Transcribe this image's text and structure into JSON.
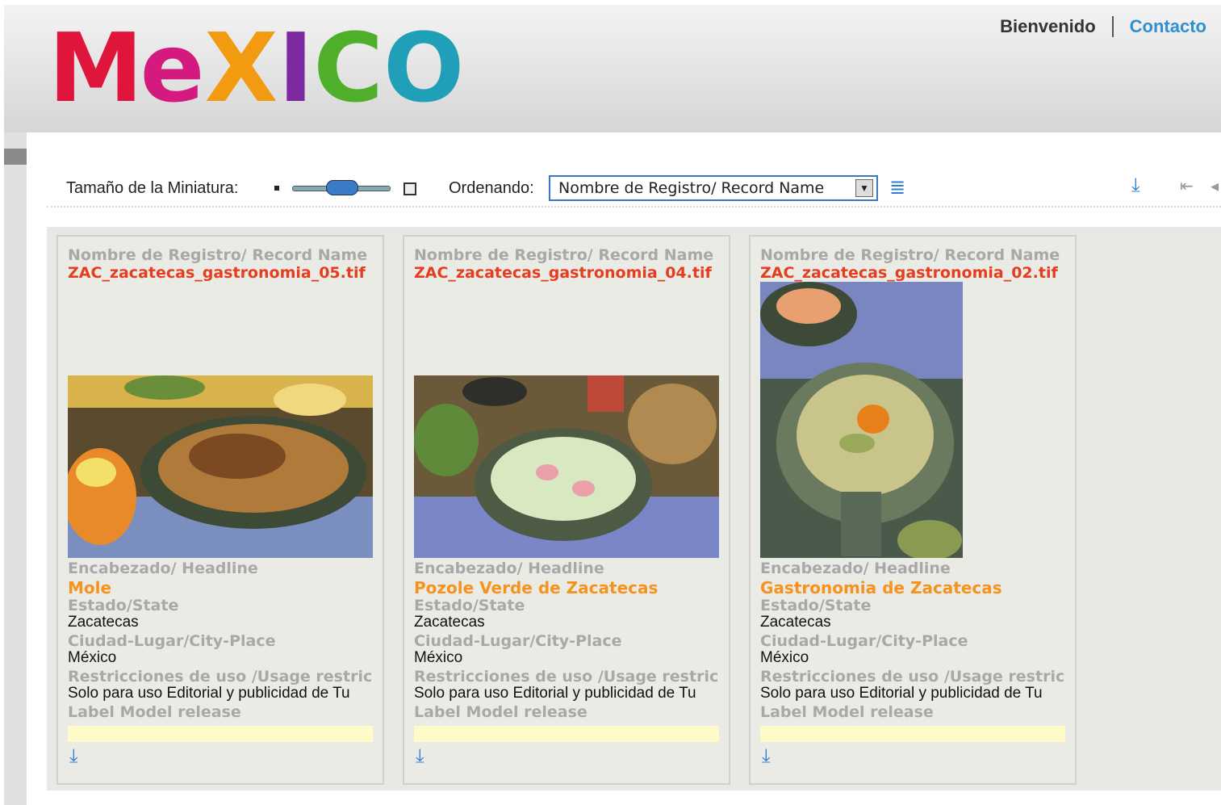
{
  "header": {
    "logo_letters": [
      "M",
      "e",
      "X",
      "I",
      "C",
      "O"
    ],
    "welcome": "Bienvenido",
    "contact": "Contacto"
  },
  "toolbar": {
    "thumb_size_label": "Tamaño de la Miniatura:",
    "sort_label": "Ordenando:",
    "sort_value": "Nombre de Registro/ Record Name"
  },
  "labels": {
    "record": "Nombre de Registro/ Record Name",
    "headline": "Encabezado/ Headline",
    "state": "Estado/State",
    "city": "Ciudad-Lugar/City-Place",
    "usage": "Restricciones de uso /Usage restric",
    "model": "Label Model release"
  },
  "cards": [
    {
      "file": "ZAC_zacatecas_gastronomia_05.tif",
      "headline": "Mole",
      "state": "Zacatecas",
      "city": "México",
      "usage": "Solo para uso Editorial y publicidad de Tu"
    },
    {
      "file": "ZAC_zacatecas_gastronomia_04.tif",
      "headline": "Pozole Verde de Zacatecas",
      "state": "Zacatecas",
      "city": "México",
      "usage": "Solo para uso Editorial y publicidad de Tu"
    },
    {
      "file": "ZAC_zacatecas_gastronomia_02.tif",
      "headline": "Gastronomia de Zacatecas",
      "state": "Zacatecas",
      "city": "México",
      "usage": "Solo para uso Editorial y publicidad de Tu"
    }
  ],
  "icons": {
    "download": "download-icon",
    "sort": "sort-list-icon",
    "first_page": "first-page-icon",
    "prev_page": "prev-page-icon"
  },
  "colors": {
    "filename": "#e43d20",
    "headline": "#f5931e",
    "link": "#2f8fd0",
    "label": "#a8a8a8"
  }
}
